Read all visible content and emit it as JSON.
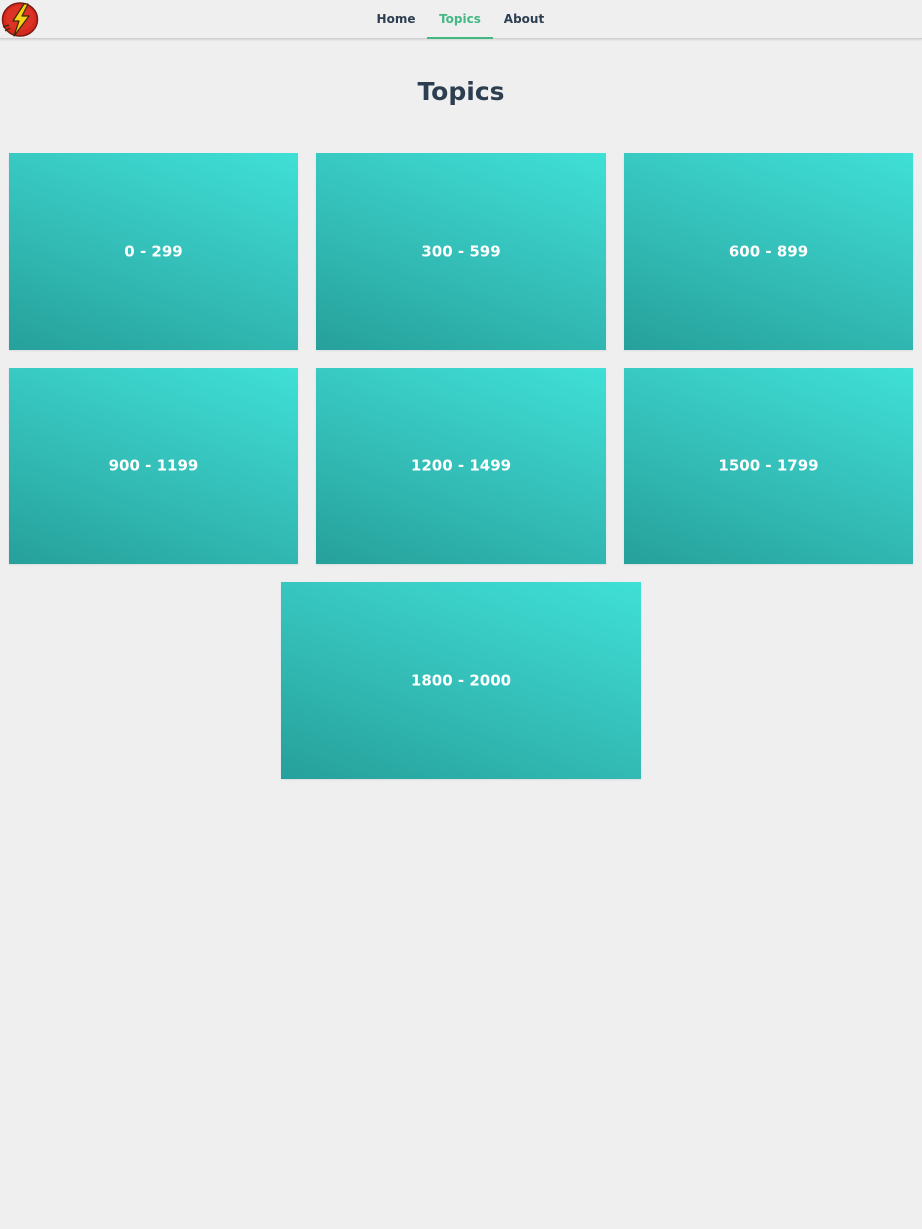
{
  "nav": {
    "logo_icon": "lightning-bolt-logo-icon",
    "links": [
      {
        "label": "Home",
        "active": false
      },
      {
        "label": "Topics",
        "active": true
      },
      {
        "label": "About",
        "active": false
      }
    ]
  },
  "main": {
    "title": "Topics",
    "cards": [
      {
        "label": "0 - 299"
      },
      {
        "label": "300 - 599"
      },
      {
        "label": "600 - 899"
      },
      {
        "label": "900 - 1199"
      },
      {
        "label": "1200 - 1499"
      },
      {
        "label": "1500 - 1799"
      },
      {
        "label": "1800 - 2000"
      }
    ]
  },
  "colors": {
    "accent": "#42b983",
    "text": "#2c3e50",
    "card_light": "#3fe0d7",
    "card_dark": "#26a09a",
    "background": "#efefef"
  }
}
